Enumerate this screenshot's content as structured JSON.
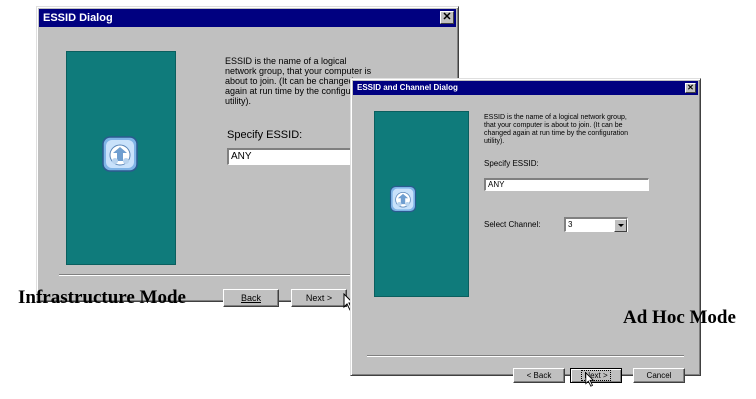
{
  "infra_dialog": {
    "title": "ESSID Dialog",
    "close_glyph": "✕",
    "message": "ESSID is the name of a logical network group, that your computer is about to join. (It can be changed again at run time by the configuration utility).",
    "essid_label": "Specify ESSID:",
    "essid_value": "ANY",
    "back_label": "Back",
    "next_label": "Next >"
  },
  "adhoc_dialog": {
    "title": "ESSID and Channel Dialog",
    "close_glyph": "✕",
    "message": "ESSID is the name of a logical network group, that your computer is about to join. (It can be changed again at run time by the configuration utility).",
    "essid_label": "Specify ESSID:",
    "essid_value": "ANY",
    "channel_label": "Select Channel:",
    "channel_value": "3",
    "back_label": "< Back",
    "next_label": "Next >",
    "cancel_label": "Cancel"
  },
  "captions": {
    "infrastructure": "Infrastructure Mode",
    "adhoc": "Ad Hoc Mode"
  },
  "colors": {
    "title_bar": "#000080",
    "panel": "#0f7b7b",
    "dialog_face": "#c0c0c0"
  },
  "icons": {
    "wizard_graphic": "network-setup-icon",
    "pointer": "mouse-pointer-icon"
  }
}
